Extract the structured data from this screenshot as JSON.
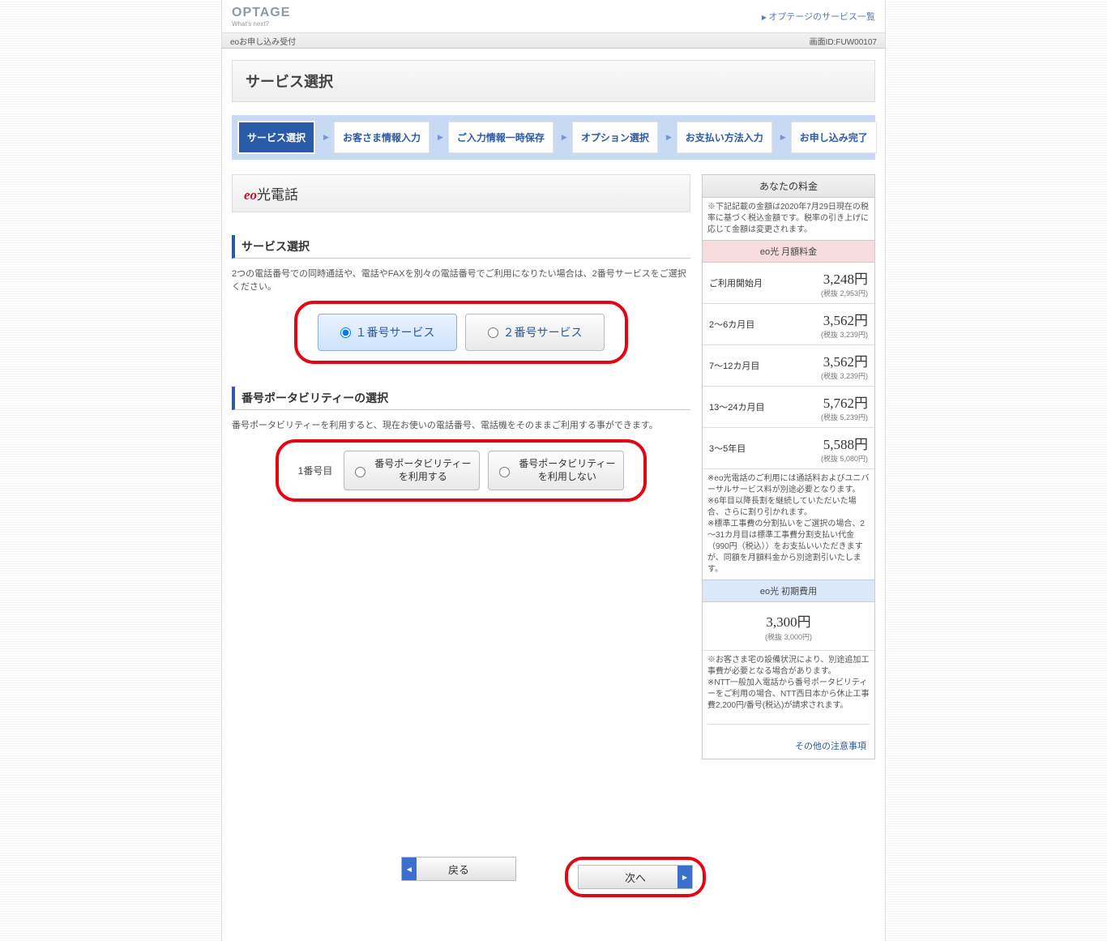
{
  "header": {
    "brand": "OPTAGE",
    "brand_tagline": "What's next?",
    "services_link": "オプテージのサービス一覧",
    "app_name": "eoお申し込み受付",
    "screen_id": "画面ID:FUW00107"
  },
  "page_title": "サービス選択",
  "steps": [
    "サービス選択",
    "お客さま情報入力",
    "ご入力情報一時保存",
    "オプション選択",
    "お支払い方法入力",
    "お申し込み完了"
  ],
  "service_header_red": "eo",
  "service_header_rest": "光電話",
  "section1_title": "サービス選択",
  "section1_desc": "2つの電話番号での同時通話や、電話やFAXを別々の電話番号でご利用になりたい場合は、2番号サービスをご選択ください。",
  "service_options": {
    "opt1": "１番号サービス",
    "opt2": "２番号サービス"
  },
  "section2_title": "番号ポータビリティーの選択",
  "section2_desc": "番号ポータビリティーを利用すると、現在お使いの電話番号、電話機をそのままご利用する事ができます。",
  "port_label": "1番号目",
  "port_options": {
    "use": "番号ポータビリティーを利用する",
    "nouse": "番号ポータビリティーを利用しない"
  },
  "sidebar": {
    "title": "あなたの料金",
    "note": "※下記記載の金額は2020年7月29日現在の税率に基づく税込金額です。税率の引き上げに応じて金額は変更されます。",
    "monthly_hdr": "eo光 月額料金",
    "rows": [
      {
        "label": "ご利用開始月",
        "price": "3,248円",
        "sub": "(税抜 2,953円)"
      },
      {
        "label": "2～6カ月目",
        "price": "3,562円",
        "sub": "(税抜 3,239円)"
      },
      {
        "label": "7～12カ月目",
        "price": "3,562円",
        "sub": "(税抜 3,239円)"
      },
      {
        "label": "13～24カ月目",
        "price": "5,762円",
        "sub": "(税抜 5,239円)"
      },
      {
        "label": "3～5年目",
        "price": "5,588円",
        "sub": "(税抜 5,080円)"
      }
    ],
    "monthly_note": "※eo光電話のご利用には通話料およびユニバーサルサービス料が別途必要となります。\n※6年目以降長割を継続していただいた場合、さらに割り引かれます。\n※標準工事費の分割払いをご選択の場合、2～31カ月目は標準工事費分割支払い代金（990円（税込））をお支払いいただきますが、同額を月額料金から別途割引いたします。",
    "initial_hdr": "eo光 初期費用",
    "initial_price": "3,300円",
    "initial_sub": "(税抜 3,000円)",
    "initial_note": "※お客さま宅の設備状況により、別途追加工事費が必要となる場合があります。\n※NTT一般加入電話から番号ポータビリティーをご利用の場合、NTT西日本から休止工事費2,200円/番号(税込)が請求されます。",
    "other_link": "その他の注意事項"
  },
  "buttons": {
    "back": "戻る",
    "next": "次へ"
  }
}
